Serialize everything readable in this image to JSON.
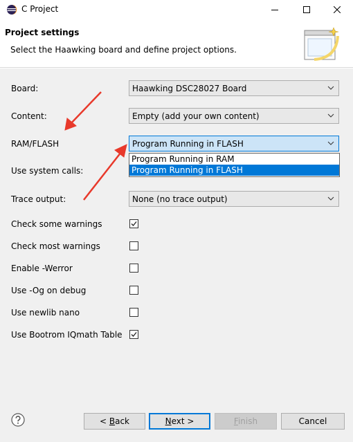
{
  "window": {
    "title": "C Project"
  },
  "banner": {
    "title": "Project settings",
    "description": "Select the Haawking board and define project options."
  },
  "fields": {
    "board": {
      "label": "Board:",
      "value": "Haawking DSC28027 Board"
    },
    "content": {
      "label": "Content:",
      "value": "Empty (add your own content)"
    },
    "ram_flash": {
      "label": "RAM/FLASH",
      "value": "Program Running in FLASH",
      "options": [
        "Program Running in RAM",
        "Program Running in FLASH"
      ],
      "selected_index": 1
    },
    "system_calls": {
      "label": "Use system calls:"
    },
    "trace_output": {
      "label": "Trace output:",
      "value": "None (no trace output)"
    }
  },
  "checkboxes": [
    {
      "label": "Check some warnings",
      "checked": true
    },
    {
      "label": "Check most warnings",
      "checked": false
    },
    {
      "label": "Enable -Werror",
      "checked": false
    },
    {
      "label": "Use -Og on debug",
      "checked": false
    },
    {
      "label": "Use newlib nano",
      "checked": false
    },
    {
      "label": "Use Bootrom IQmath Table",
      "checked": true
    }
  ],
  "footer": {
    "back_prefix": "< ",
    "back_mnemonic": "B",
    "back_rest": "ack",
    "next_mnemonic": "N",
    "next_rest": "ext >",
    "finish_mnemonic": "F",
    "finish_rest": "inish",
    "cancel_label": "Cancel"
  },
  "colors": {
    "accent": "#0078d7",
    "annotation_arrow": "#e8392b",
    "dialog_bg": "#f0f0f0"
  }
}
